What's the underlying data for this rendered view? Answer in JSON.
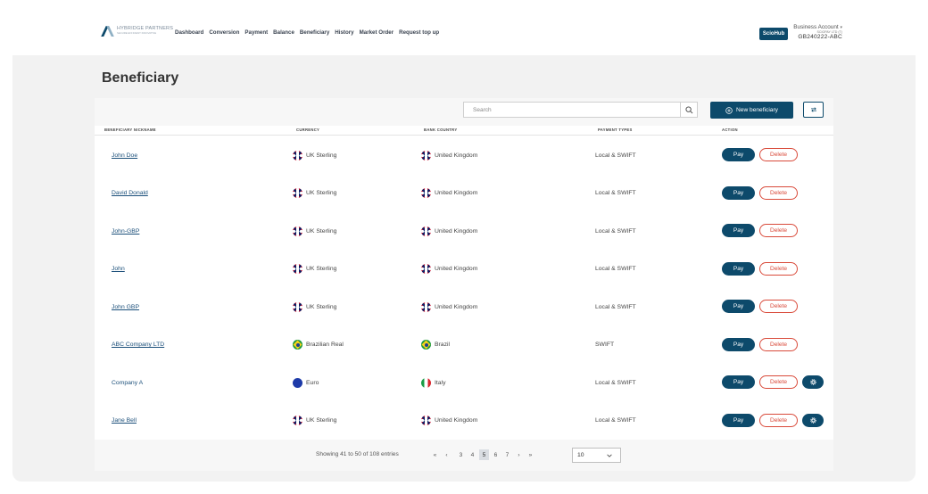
{
  "header": {
    "logo_text": "HYBRIDGE PARTNERS",
    "logo_sub": "SECURE EFFICIENT INNOVATIVE",
    "nav": [
      "Dashboard",
      "Conversion",
      "Payment",
      "Balance",
      "Beneficiary",
      "History",
      "Market Order",
      "Request top up"
    ],
    "account_badge": "ScioHub",
    "account_type": "Business Account",
    "account_company": "SCIOPAY LTD (T)",
    "account_id": "GB240222-ABC"
  },
  "page": {
    "title": "Beneficiary"
  },
  "toolbar": {
    "search_placeholder": "Search",
    "new_button": "New beneficiary"
  },
  "table": {
    "columns": [
      "BENEFICIARY NICKNAME",
      "CURRENCY",
      "BANK COUNTRY",
      "PAYMENT TYPES",
      "ACTION"
    ],
    "pay_label": "Pay",
    "delete_label": "Delete",
    "rows": [
      {
        "nickname": "John Doe",
        "link": true,
        "currency": "UK Sterling",
        "currency_flag": "uk",
        "country": "United Kingdom",
        "country_flag": "uk",
        "payment_types": "Local & SWIFT",
        "extra": false
      },
      {
        "nickname": "David Donald",
        "link": true,
        "currency": "UK Sterling",
        "currency_flag": "uk",
        "country": "United Kingdom",
        "country_flag": "uk",
        "payment_types": "Local & SWIFT",
        "extra": false
      },
      {
        "nickname": "John-GBP",
        "link": true,
        "currency": "UK Sterling",
        "currency_flag": "uk",
        "country": "United Kingdom",
        "country_flag": "uk",
        "payment_types": "Local & SWIFT",
        "extra": false
      },
      {
        "nickname": "John",
        "link": true,
        "currency": "UK Sterling",
        "currency_flag": "uk",
        "country": "United Kingdom",
        "country_flag": "uk",
        "payment_types": "Local & SWIFT",
        "extra": false
      },
      {
        "nickname": "John GBP",
        "link": true,
        "currency": "UK Sterling",
        "currency_flag": "uk",
        "country": "United Kingdom",
        "country_flag": "uk",
        "payment_types": "Local & SWIFT",
        "extra": false
      },
      {
        "nickname": "ABC Company LTD",
        "link": true,
        "currency": "Brazilian Real",
        "currency_flag": "br",
        "country": "Brazil",
        "country_flag": "br",
        "payment_types": "SWIFT",
        "extra": false
      },
      {
        "nickname": "Company A",
        "link": false,
        "currency": "Euro",
        "currency_flag": "eu",
        "country": "Italy",
        "country_flag": "it",
        "payment_types": "Local & SWIFT",
        "extra": true
      },
      {
        "nickname": "Jane Bell",
        "link": true,
        "currency": "UK Sterling",
        "currency_flag": "uk",
        "country": "United Kingdom",
        "country_flag": "uk",
        "payment_types": "Local & SWIFT",
        "extra": true
      }
    ]
  },
  "pagination": {
    "showing": "Showing 41 to 50 of 108 entries",
    "first": "«",
    "prev": "‹",
    "pages": [
      "3",
      "4",
      "5",
      "6",
      "7"
    ],
    "active_page": "5",
    "next": "›",
    "last": "»",
    "per_page": "10"
  }
}
